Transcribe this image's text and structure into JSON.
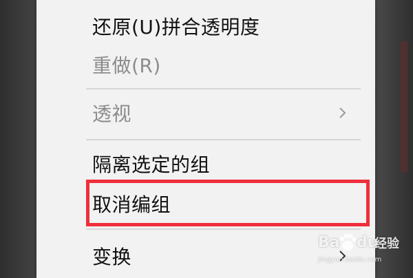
{
  "context_menu": {
    "items": [
      {
        "label": "还原(U)拼合透明度",
        "enabled": true
      },
      {
        "label": "重做(R)",
        "enabled": false
      },
      {
        "label": "透视",
        "enabled": false,
        "has_submenu": true
      },
      {
        "label": "隔离选定的组",
        "enabled": true
      },
      {
        "label": "取消编组",
        "enabled": true,
        "highlighted": true
      },
      {
        "label": "变换",
        "enabled": true,
        "has_submenu": true
      }
    ]
  },
  "annotation": {
    "color": "#ef2f3c"
  },
  "watermark": {
    "brand_left": "Ba",
    "brand_right": "du",
    "suffix": "经验",
    "url": "jingyan.baidu.com"
  }
}
